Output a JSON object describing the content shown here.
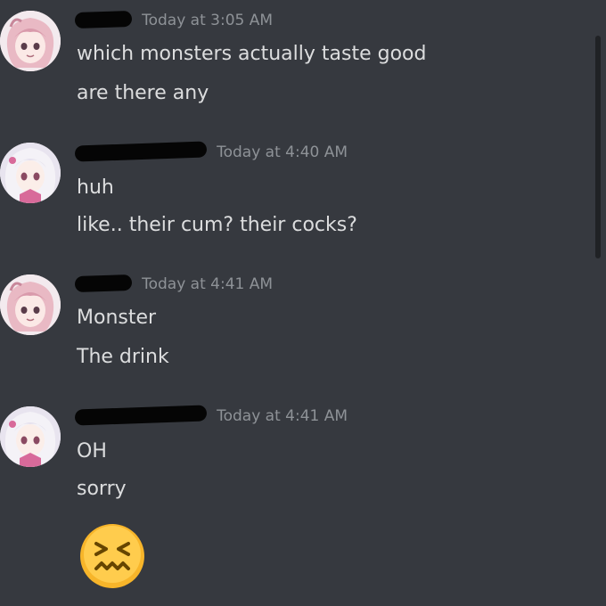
{
  "messages": [
    {
      "avatar": "pink-haired-anime-avatar",
      "timestamp": "Today at 3:05 AM",
      "lines": [
        "which monsters actually taste good",
        "are there any"
      ]
    },
    {
      "avatar": "white-haired-anime-avatar",
      "timestamp": "Today at 4:40 AM",
      "lines": [
        "huh",
        "like.. their cum? their cocks?"
      ]
    },
    {
      "avatar": "pink-haired-anime-avatar",
      "timestamp": "Today at 4:41 AM",
      "lines": [
        "Monster",
        "The drink"
      ]
    },
    {
      "avatar": "white-haired-anime-avatar",
      "timestamp": "Today at 4:41 AM",
      "lines": [
        "OH",
        "sorry"
      ],
      "emoji": "confounded-face-emoji"
    }
  ],
  "colors": {
    "background": "#36393f",
    "text": "#dcddde",
    "timestamp": "#8e9297",
    "redaction": "#050505"
  }
}
